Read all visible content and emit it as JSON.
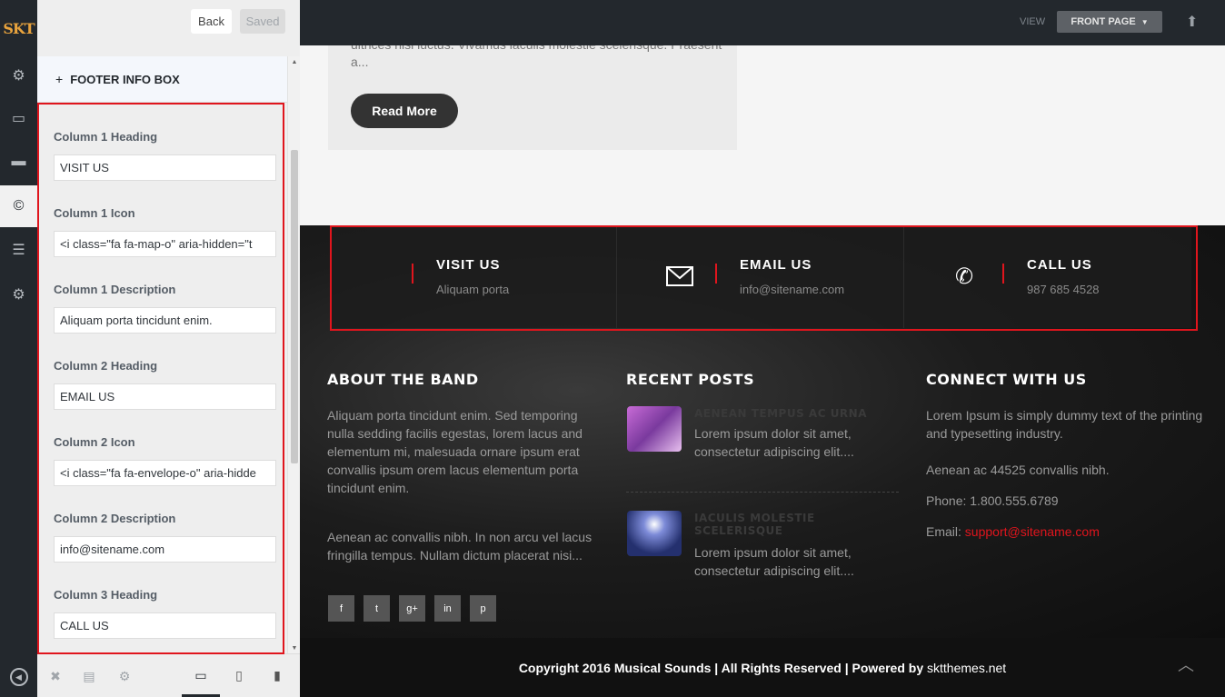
{
  "rail": {
    "logo": "SKT",
    "icons": [
      "gear-icon",
      "card-icon",
      "monitor-icon",
      "copyright-icon",
      "list-icon",
      "settings-icon"
    ]
  },
  "panel": {
    "back_label": "Back",
    "saved_label": "Saved",
    "section_title": "FOOTER INFO BOX",
    "section_plus": "+",
    "fields": [
      {
        "label": "Column 1 Heading",
        "value": "VISIT US"
      },
      {
        "label": "Column 1 Icon",
        "value": "<i class=\"fa fa-map-o\" aria-hidden=\"t"
      },
      {
        "label": "Column 1 Description",
        "value": "Aliquam porta tincidunt enim."
      },
      {
        "label": "Column 2 Heading",
        "value": "EMAIL US"
      },
      {
        "label": "Column 2 Icon",
        "value": "<i class=\"fa fa-envelope-o\" aria-hidde"
      },
      {
        "label": "Column 2 Description",
        "value": "info@sitename.com"
      },
      {
        "label": "Column 3 Heading",
        "value": "CALL US"
      }
    ]
  },
  "preview": {
    "view_label": "VIEW",
    "view_selected": "FRONT PAGE",
    "post_excerpt": "ultrices nisi luctus. Vivamus iaculis molestie scelerisque. Praesent a...",
    "read_more": "Read More",
    "infobox": [
      {
        "heading": "VISIT US",
        "desc": "Aliquam porta",
        "icon": "map-icon"
      },
      {
        "heading": "EMAIL US",
        "desc": "info@sitename.com",
        "icon": "envelope-icon"
      },
      {
        "heading": "CALL US",
        "desc": "987 685 4528",
        "icon": "phone-icon"
      }
    ],
    "about": {
      "title": "ABOUT THE BAND",
      "p1": "Aliquam porta tincidunt enim. Sed temporing nulla sedding facilis egestas, lorem lacus and elementum mi, malesuada ornare ipsum erat convallis ipsum orem lacus elementum porta tincidunt enim.",
      "p2": "Aenean ac convallis nibh. In non arcu vel lacus fringilla tempus. Nullam dictum placerat nisi..."
    },
    "social": [
      "f",
      "t",
      "g+",
      "in",
      "p"
    ],
    "recent": {
      "title": "RECENT POSTS",
      "posts": [
        {
          "title": "AENEAN TEMPUS AC URNA",
          "excerpt": "Lorem ipsum dolor sit amet, consectetur adipiscing elit...."
        },
        {
          "title": "IACULIS MOLESTIE SCELERISQUE",
          "excerpt": "Lorem ipsum dolor sit amet, consectetur adipiscing elit...."
        }
      ]
    },
    "connect": {
      "title": "CONNECT WITH US",
      "intro": "Lorem Ipsum is simply dummy text of the printing and typesetting industry.",
      "address": "Aenean ac 44525 convallis nibh.",
      "phone": "Phone: 1.800.555.6789",
      "email_label": "Email:",
      "email": "support@sitename.com"
    },
    "copyright_text": "Copyright 2016 Musical Sounds | All Rights Reserved | Powered by",
    "copyright_link": "sktthemes.net"
  },
  "colors": {
    "accent_red": "#e0151d",
    "rail_bg": "#23282d",
    "logo": "#e8a33d"
  }
}
